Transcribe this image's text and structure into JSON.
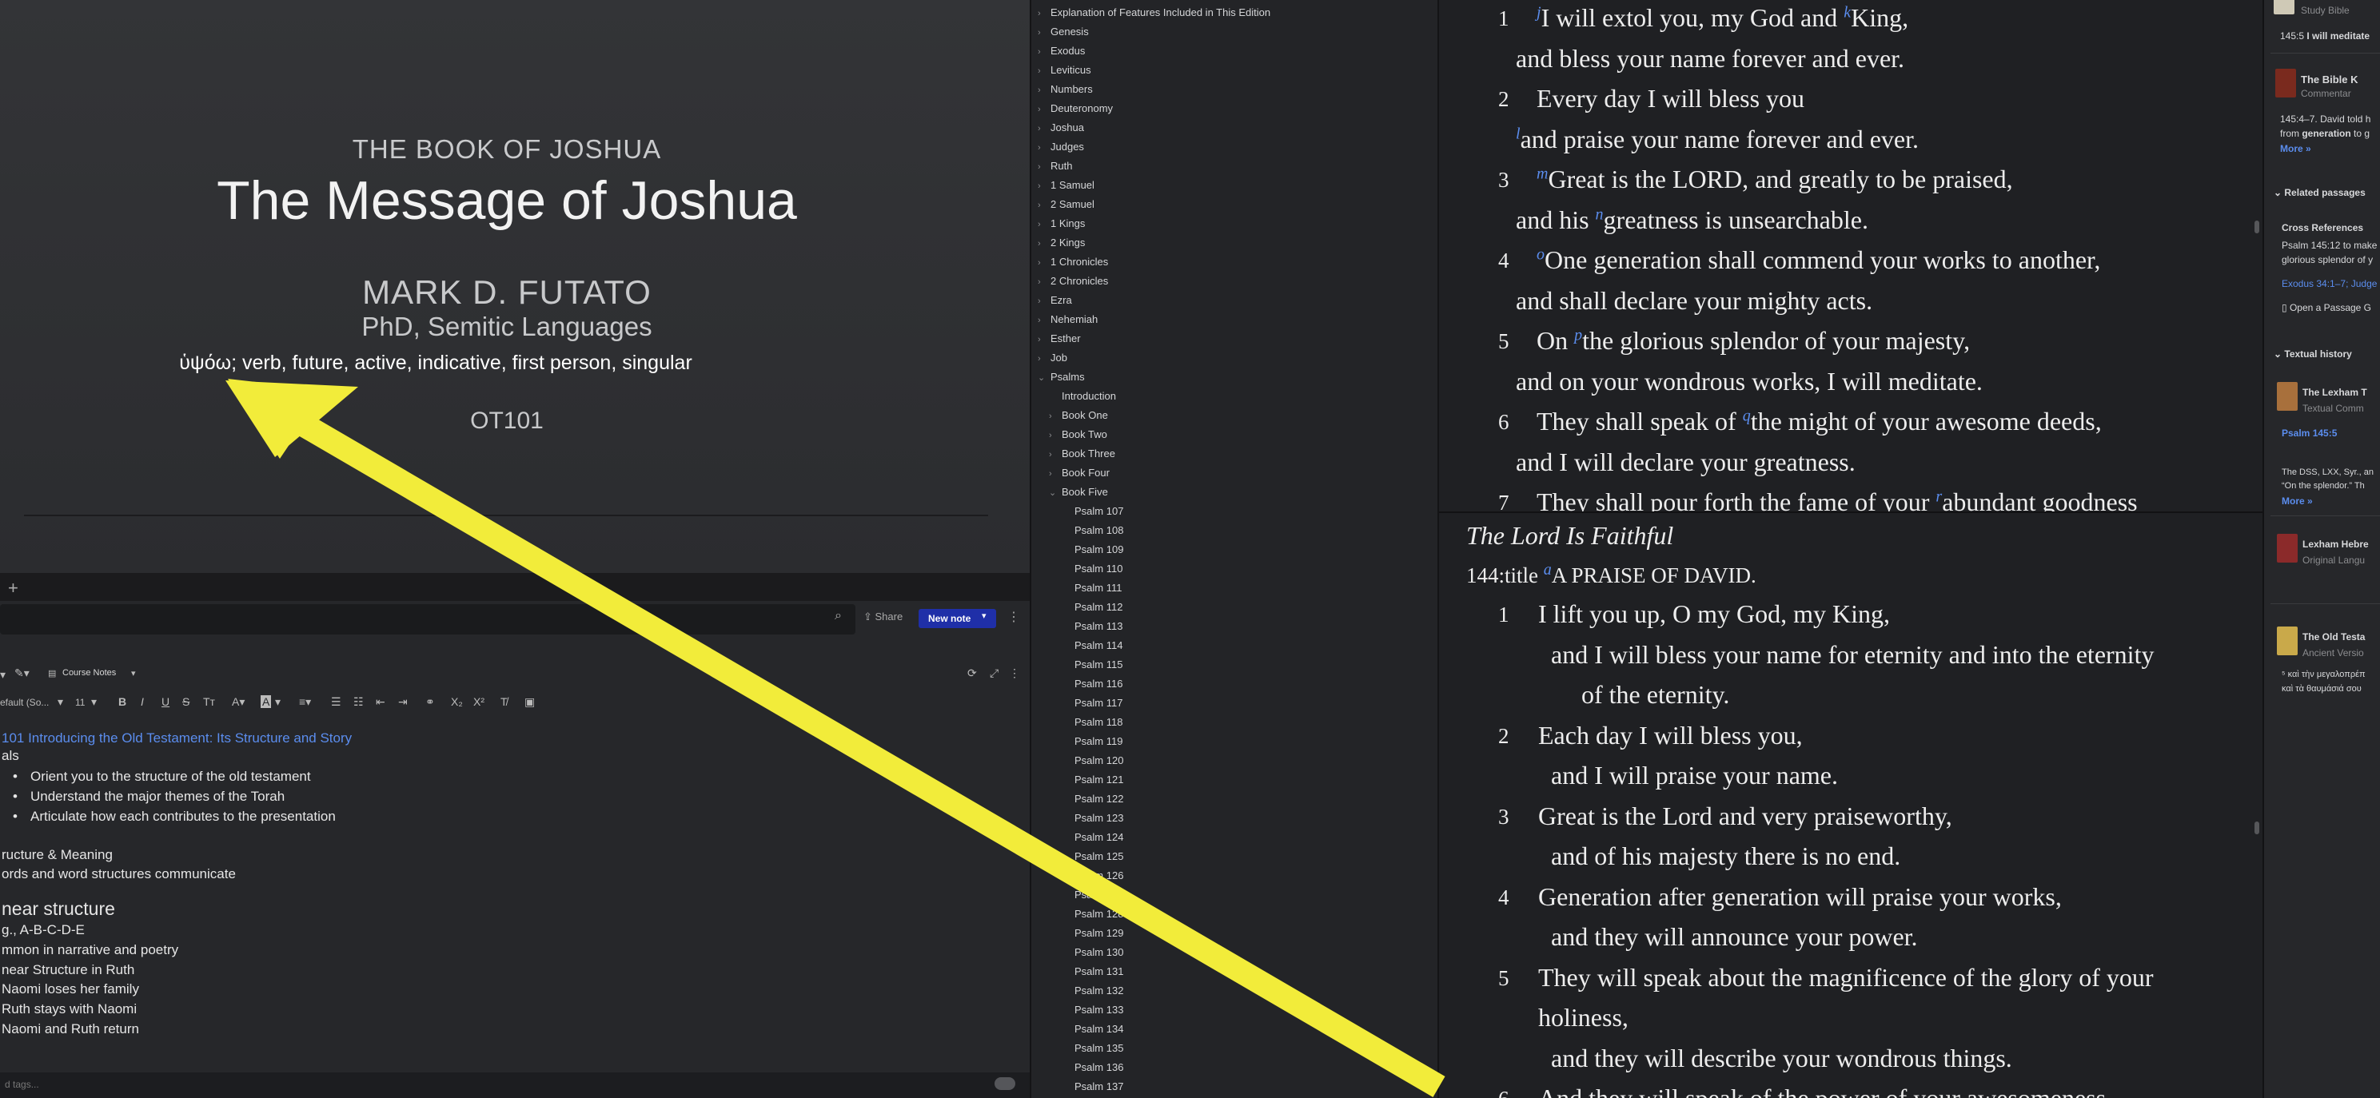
{
  "slide": {
    "kicker": "THE BOOK OF JOSHUA",
    "title": "The Message of Joshua",
    "author": "MARK D. FUTATO",
    "degree": "PhD, Semitic Languages",
    "parsing": "ὑψόω; verb, future, active, indicative, first person, singular",
    "course": "OT101"
  },
  "tabs": {
    "add": "+"
  },
  "notes": {
    "share_label": "Share",
    "new_note_label": "New note",
    "notebook_label": "Course Notes",
    "font_label": "efault (So...",
    "font_size": "11",
    "doc": {
      "title": "101 Introducing the Old Testament: Its Structure and Story",
      "goals": "als",
      "goal_items": [
        "Orient you to the structure of the old testament",
        "Understand the major themes of the Torah",
        "Articulate how each contributes to the presentation"
      ],
      "lines": [
        "ructure & Meaning",
        "ords and word structures communicate"
      ],
      "heading": "near structure",
      "sub_lines": [
        "g., A-B-C-D-E",
        "mmon in narrative and poetry",
        "near Structure in Ruth",
        "Naomi loses her family",
        "Ruth stays with Naomi",
        "Naomi and Ruth return"
      ]
    },
    "tags_placeholder": "d tags..."
  },
  "tree": {
    "top_items": [
      "Explanation of Features Included in This Edition",
      "Genesis",
      "Exodus",
      "Leviticus",
      "Numbers",
      "Deuteronomy",
      "Joshua",
      "Judges",
      "Ruth",
      "1 Samuel",
      "2 Samuel",
      "1 Kings",
      "2 Kings",
      "1 Chronicles",
      "2 Chronicles",
      "Ezra",
      "Nehemiah",
      "Esther",
      "Job"
    ],
    "psalms": "Psalms",
    "psalms_children": [
      "Introduction"
    ],
    "books": [
      "Book One",
      "Book Two",
      "Book Three",
      "Book Four"
    ],
    "book_five": "Book Five",
    "psalm_list": [
      "Psalm 107",
      "Psalm 108",
      "Psalm 109",
      "Psalm 110",
      "Psalm 111",
      "Psalm 112",
      "Psalm 113",
      "Psalm 114",
      "Psalm 115",
      "Psalm 116",
      "Psalm 117",
      "Psalm 118",
      "Psalm 119",
      "Psalm 120",
      "Psalm 121",
      "Psalm 122",
      "Psalm 123",
      "Psalm 124",
      "Psalm 125",
      "Psalm 126",
      "Psalm 127",
      "Psalm 128",
      "Psalm 129",
      "Psalm 130",
      "Psalm 131",
      "Psalm 132",
      "Psalm 133",
      "Psalm 134",
      "Psalm 135",
      "Psalm 136",
      "Psalm 137"
    ]
  },
  "bible1": {
    "verses": [
      {
        "num": "1",
        "fn": "j",
        "text": "I will extol you, my God and ",
        "fn2": "k",
        "text2": "King,"
      },
      {
        "num": "",
        "text": "and bless your name forever and ever."
      },
      {
        "num": "2",
        "text": "Every day I will bless you"
      },
      {
        "num": "",
        "fn": "l",
        "text": "and praise your name forever and ever."
      },
      {
        "num": "3",
        "fn": "m",
        "text": "Great is the LORD, and greatly to be praised,"
      },
      {
        "num": "",
        "text": "and his ",
        "fn2": "n",
        "text2": "greatness is unsearchable."
      },
      {
        "num": "4",
        "fn": "o",
        "text": "One generation shall commend your works to another,"
      },
      {
        "num": "",
        "text": "and shall declare your mighty acts."
      },
      {
        "num": "5",
        "text": "On ",
        "fn2": "p",
        "text2": "the glorious splendor of your majesty,"
      },
      {
        "num": "",
        "text": "and on your wondrous works, I will meditate."
      },
      {
        "num": "6",
        "text": "They shall speak of ",
        "fn2": "q",
        "text2": "the might of your awesome deeds,"
      },
      {
        "num": "",
        "text": "and I will declare your greatness."
      },
      {
        "num": "7",
        "text": "They shall pour forth the fame of your ",
        "fn2": "r",
        "text2": "abundant goodness"
      }
    ]
  },
  "bible2": {
    "heading": "The Lord Is Faithful",
    "title_ref": "144:title",
    "title_fn": "a",
    "title_text": "A PRAISE OF DAVID.",
    "verses": [
      {
        "num": "1",
        "text": "I lift you up, O my God, my King,"
      },
      {
        "num": "",
        "text": "and I will bless your name for eternity and into the eternity"
      },
      {
        "num": "",
        "text": "of the eternity."
      },
      {
        "num": "2",
        "text": "Each day I will bless you,"
      },
      {
        "num": "",
        "text": "and I will praise your name."
      },
      {
        "num": "3",
        "text": "Great is the Lord and very praiseworthy,"
      },
      {
        "num": "",
        "text": "and of his majesty there is no end."
      },
      {
        "num": "4",
        "text": "Generation after generation will praise your works,"
      },
      {
        "num": "",
        "text": "and they will announce your power."
      },
      {
        "num": "5",
        "text": "They will speak about the magnificence of the glory of your"
      },
      {
        "num": "",
        "text": "holiness,"
      },
      {
        "num": "",
        "text": "and they will describe your wondrous things."
      },
      {
        "num": "6",
        "text": "And they will speak of the power of your awesomeness"
      }
    ]
  },
  "side": {
    "study_bible": "Study Bible",
    "ref1": "145:5",
    "ref1_text": "I will meditate",
    "bk_title": "The Bible K",
    "bk_sub": "Commentar",
    "bk_ref": "145:4–7.",
    "bk_text1": "David told h",
    "bk_text2": "from ",
    "bk_text2b": "generation",
    "bk_text2c": " to g",
    "more1": "More »",
    "related": "Related passages",
    "cross_refs": "Cross References",
    "cr_ref": "Psalm 145:12",
    "cr_text": " to make",
    "cr_text2": "glorious splendor of y",
    "cr_ref2": "Exodus 34:1–7; Judge",
    "open_passage": "Open a Passage G",
    "textual": "Textual history",
    "lexham_title": "The Lexham T",
    "lexham_sub": "Textual Comm",
    "lexham_ref": "Psalm 145:5",
    "lexham_text1": "The DSS, LXX, Syr., an",
    "lexham_text2": "“On the splendor.” Th",
    "more2": "More »",
    "lexham_heb": "Lexham Hebre",
    "lexham_heb_sub": "Original Langu",
    "ot_title": "The Old Testa",
    "ot_sub": "Ancient Versio",
    "ot_text1": "⁵ καὶ τὴν μεγαλοπρέπ",
    "ot_text2": "καὶ τὰ θαυμάσιά σου"
  },
  "colors": {
    "accent": "#5b8dee",
    "arrow": "#f2ec3a",
    "new_note": "#1f2fa8"
  }
}
